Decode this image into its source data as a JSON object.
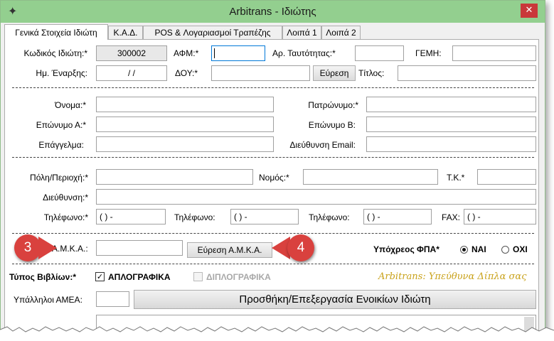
{
  "window": {
    "title": "Arbitrans - Ιδιώτης",
    "icon": "app-logo-icon",
    "close_glyph": "✕"
  },
  "tabs": [
    {
      "label": "Γενικά Στοιχεία Ιδιώτη",
      "active": true
    },
    {
      "label": "Κ.Α.Δ."
    },
    {
      "label": "POS & Λογαριασμοί Τραπέζης"
    },
    {
      "label": "Λοιπά 1"
    },
    {
      "label": "Λοιπά 2"
    }
  ],
  "fields": {
    "code": {
      "label": "Κωδικός Ιδιώτη:*",
      "value": "300002"
    },
    "afm": {
      "label": "ΑΦΜ:*",
      "value": ""
    },
    "id_card": {
      "label": "Αρ. Ταυτότητας:*",
      "value": ""
    },
    "gemi": {
      "label": "ΓΕΜΗ:",
      "value": ""
    },
    "start_date": {
      "label": "Ημ. Έναρξης:",
      "value": "/ /"
    },
    "doy": {
      "label": "ΔΟΥ:*",
      "value": ""
    },
    "doy_search": "Εύρεση",
    "title": {
      "label": "Τίτλος:",
      "value": ""
    },
    "first_name": {
      "label": "Όνομα:*",
      "value": ""
    },
    "father_name": {
      "label": "Πατρώνυμο:*",
      "value": ""
    },
    "surname_a": {
      "label": "Επώνυμο Α:*",
      "value": ""
    },
    "surname_b": {
      "label": "Επώνυμο Β:",
      "value": ""
    },
    "profession": {
      "label": "Επάγγελμα:",
      "value": ""
    },
    "email": {
      "label": "Διεύθυνση Email:",
      "value": ""
    },
    "city": {
      "label": "Πόλη/Περιοχή:*",
      "value": ""
    },
    "prefecture": {
      "label": "Νομός:*",
      "value": ""
    },
    "zip": {
      "label": "Τ.Κ.*",
      "value": ""
    },
    "address": {
      "label": "Διεύθυνση:*",
      "value": ""
    },
    "phone1": {
      "label": "Τηλέφωνο:*",
      "value": "(  )   -"
    },
    "phone2": {
      "label": "Τηλέφωνο:",
      "value": "(  )   -"
    },
    "phone3": {
      "label": "Τηλέφωνο:",
      "value": "(  )   -"
    },
    "fax": {
      "label": "FAX:",
      "value": "(  )   -"
    },
    "amka": {
      "label": "Α.Μ.Κ.Α.:",
      "value": ""
    },
    "amka_search": "Εύρεση Α.Μ.Κ.Α.",
    "vat": {
      "label": "Υπόχρεος ΦΠΑ*",
      "yes": "ΝΑΙ",
      "no": "ΟΧΙ",
      "selected": "ΝΑΙ"
    },
    "books": {
      "label": "Τύπος Βιβλίων:*",
      "single": "ΑΠΛΟΓΡΑΦΙΚΑ",
      "double": "ΔΙΠΛΟΓΡΑΦΙΚΑ",
      "single_checked": true,
      "double_enabled": false
    },
    "tagline": "Arbitrans: Υπεύθυνα Δίπλα σας",
    "amea": {
      "label": "Υπάλληλοι ΑΜΕΑ:",
      "value": ""
    },
    "rentals_button": "Προσθήκη/Επεξεργασία Ενοικίων Ιδιώτη"
  },
  "callouts": [
    {
      "number": "3"
    },
    {
      "number": "4"
    }
  ],
  "colors": {
    "titlebar": "#93cf8f",
    "close": "#c9383a",
    "callout": "#d9413e",
    "tagline": "#c9a21a"
  }
}
